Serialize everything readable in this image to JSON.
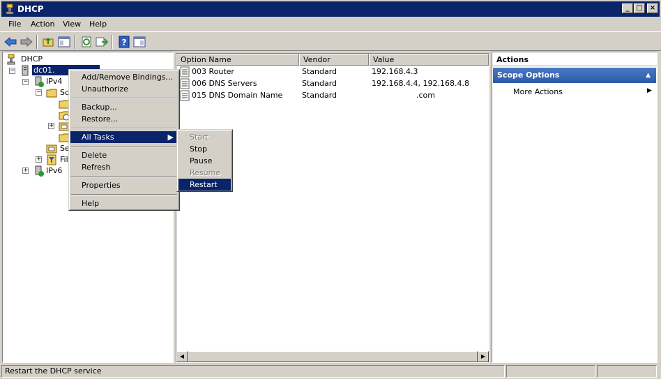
{
  "window": {
    "title": "DHCP",
    "buttons": [
      "_",
      "□",
      "×"
    ]
  },
  "menubar": [
    "File",
    "Action",
    "View",
    "Help"
  ],
  "toolbar": {
    "icons": [
      "back-arrow-icon",
      "forward-arrow-icon",
      "up-folder-icon",
      "show-hide-tree-icon",
      "refresh-icon",
      "export-list-icon",
      "help-icon",
      "show-hide-action-pane-icon"
    ]
  },
  "tree": {
    "root": "DHCP",
    "server": "dc01.",
    "ipv4": "IPv4",
    "scope": "Sc",
    "server_options": "Se",
    "filters": "Filt",
    "ipv6": "IPv6"
  },
  "list": {
    "columns": [
      "Option Name",
      "Vendor",
      "Value"
    ],
    "rows": [
      {
        "name": "003 Router",
        "vendor": "Standard",
        "value": "192.168.4.3"
      },
      {
        "name": "006 DNS Servers",
        "vendor": "Standard",
        "value": "192.168.4.4, 192.168.4.8"
      },
      {
        "name": "015 DNS Domain Name",
        "vendor": "Standard",
        "value": ".com"
      }
    ]
  },
  "actions": {
    "header": "Actions",
    "section": "Scope Options",
    "more": "More Actions"
  },
  "context_menu": {
    "items": [
      "Add/Remove Bindings...",
      "Unauthorize",
      "Backup...",
      "Restore...",
      "All Tasks",
      "Delete",
      "Refresh",
      "Properties",
      "Help"
    ]
  },
  "submenu": {
    "items": [
      "Start",
      "Stop",
      "Pause",
      "Resume",
      "Restart"
    ],
    "disabled": [
      "Start",
      "Resume"
    ],
    "highlighted": "Restart"
  },
  "statusbar": {
    "text": "Restart the DHCP service"
  },
  "colors": {
    "title_bg": "#0a246a",
    "highlight": "#0a246a",
    "section_bg": "#3a68b8"
  }
}
